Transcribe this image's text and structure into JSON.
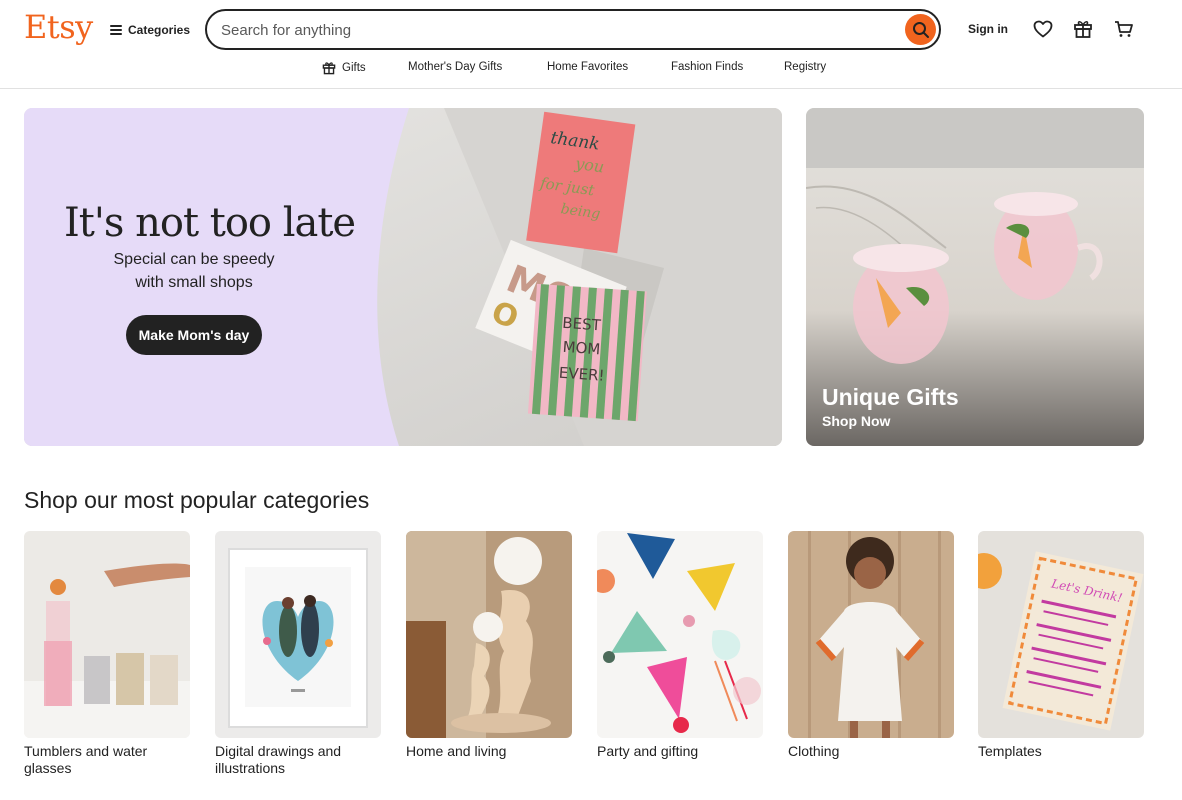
{
  "header": {
    "logo": "Etsy",
    "categories_label": "Categories",
    "search_placeholder": "Search for anything",
    "signin_label": "Sign in",
    "accent_color": "#F1641E"
  },
  "subnav": [
    {
      "label": "Gifts",
      "icon": "gift-icon"
    },
    {
      "label": "Mother's Day Gifts"
    },
    {
      "label": "Home Favorites"
    },
    {
      "label": "Fashion Finds"
    },
    {
      "label": "Registry"
    }
  ],
  "hero": {
    "title": "It's not too late",
    "subtitle_line1": "Special can be speedy",
    "subtitle_line2": "with small shops",
    "button_label": "Make Mom's day",
    "card_text_1": "thank you for just being you",
    "card_text_2": "MOM",
    "card_text_3": "BEST MOM EVER!"
  },
  "side_promo": {
    "title": "Unique Gifts",
    "subtitle": "Shop Now"
  },
  "section_title": "Shop our most popular categories",
  "categories": [
    {
      "label": "Tumblers and water glasses"
    },
    {
      "label": "Digital drawings and illustrations"
    },
    {
      "label": "Home and living"
    },
    {
      "label": "Party and gifting"
    },
    {
      "label": "Clothing"
    },
    {
      "label": "Templates"
    }
  ]
}
